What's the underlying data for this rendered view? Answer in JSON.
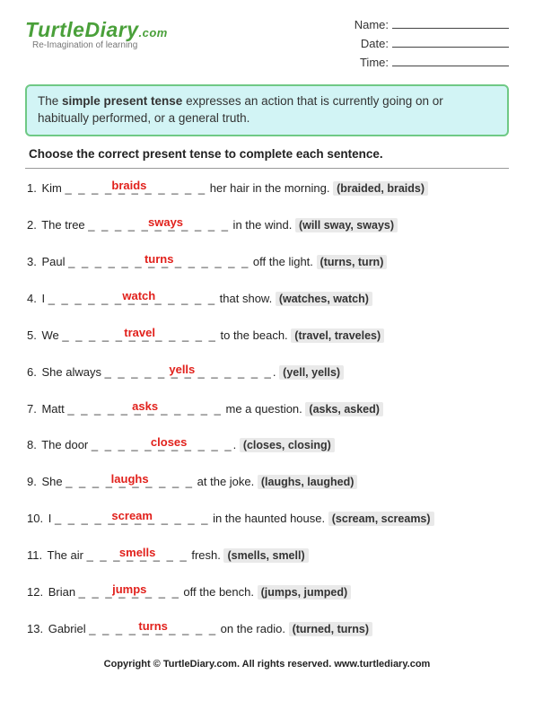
{
  "brand": {
    "name": "TurtleDiary",
    "dotcom": ".com",
    "tagline": "Re-Imagination of learning"
  },
  "meta": {
    "name_label": "Name:",
    "date_label": "Date:",
    "time_label": "Time:"
  },
  "hint_html": "The <b>simple present tense</b> expresses an action that is currently going on or habitually performed, or a general truth.",
  "instruction": "Choose the correct present tense to complete each sentence.",
  "questions": [
    {
      "n": "1.",
      "pre": "Kim ",
      "ld": "_ _ _",
      "ans": "braids",
      "rd": "_ _ _ _",
      "post": " her hair in the morning.",
      "opts": "(braided, braids)"
    },
    {
      "n": "2.",
      "pre": "The tree ",
      "ld": "_ _ _ _",
      "ans": "sways",
      "rd": "_ _ _",
      "post": " in the wind.",
      "opts": "(will sway, sways)"
    },
    {
      "n": "3.",
      "pre": "Paul ",
      "ld": "_ _ _ _ _",
      "ans": "turns",
      "rd": "_ _ _ _ _",
      "post": " off the light.",
      "opts": "(turns, turn)"
    },
    {
      "n": "4.",
      "pre": "I ",
      "ld": "_ _ _ _ _",
      "ans": "watch",
      "rd": "_ _ _ _",
      "post": " that show.",
      "opts": "(watches, watch)"
    },
    {
      "n": "5.",
      "pre": "We ",
      "ld": "_ _ _ _",
      "ans": "travel",
      "rd": "_ _ _ _",
      "post": " to the beach.",
      "opts": "(travel, traveles)"
    },
    {
      "n": "6.",
      "pre": "She always ",
      "ld": "_ _ _ _",
      "ans": "yells",
      "rd": "_ _ _ _ _",
      "post": ".",
      "opts": "(yell, yells)"
    },
    {
      "n": "7.",
      "pre": "Matt ",
      "ld": "_ _ _ _",
      "ans": "asks",
      "rd": "_ _ _ _",
      "post": " me a question.",
      "opts": "(asks, asked)"
    },
    {
      "n": "8.",
      "pre": "The door ",
      "ld": "_ _ _ _",
      "ans": "closes",
      "rd": "_ _ _",
      "post": ".",
      "opts": "(closes, closing)"
    },
    {
      "n": "9.",
      "pre": "She ",
      "ld": "_ _ _",
      "ans": "laughs",
      "rd": "_ _ _",
      "post": " at the joke.",
      "opts": "(laughs, laughed)"
    },
    {
      "n": "10.",
      "pre": "I ",
      "ld": "_ _ _ _",
      "ans": "scream",
      "rd": "_ _ _ _",
      "post": " in the haunted house.",
      "opts": "(scream, screams)"
    },
    {
      "n": "11.",
      "pre": "The air ",
      "ld": "_ _",
      "ans": "smells",
      "rd": "_ _",
      "post": " fresh.",
      "opts": "(smells, smell)"
    },
    {
      "n": "12.",
      "pre": "Brian ",
      "ld": "_ _",
      "ans": "jumps",
      "rd": "_ _",
      "post": " off the bench.",
      "opts": "(jumps, jumped)"
    },
    {
      "n": "13.",
      "pre": "Gabriel ",
      "ld": "_ _ _",
      "ans": "turns",
      "rd": "_ _ _",
      "post": " on the radio.",
      "opts": "(turned, turns)"
    }
  ],
  "footer": "Copyright © TurtleDiary.com. All rights reserved. www.turtlediary.com"
}
